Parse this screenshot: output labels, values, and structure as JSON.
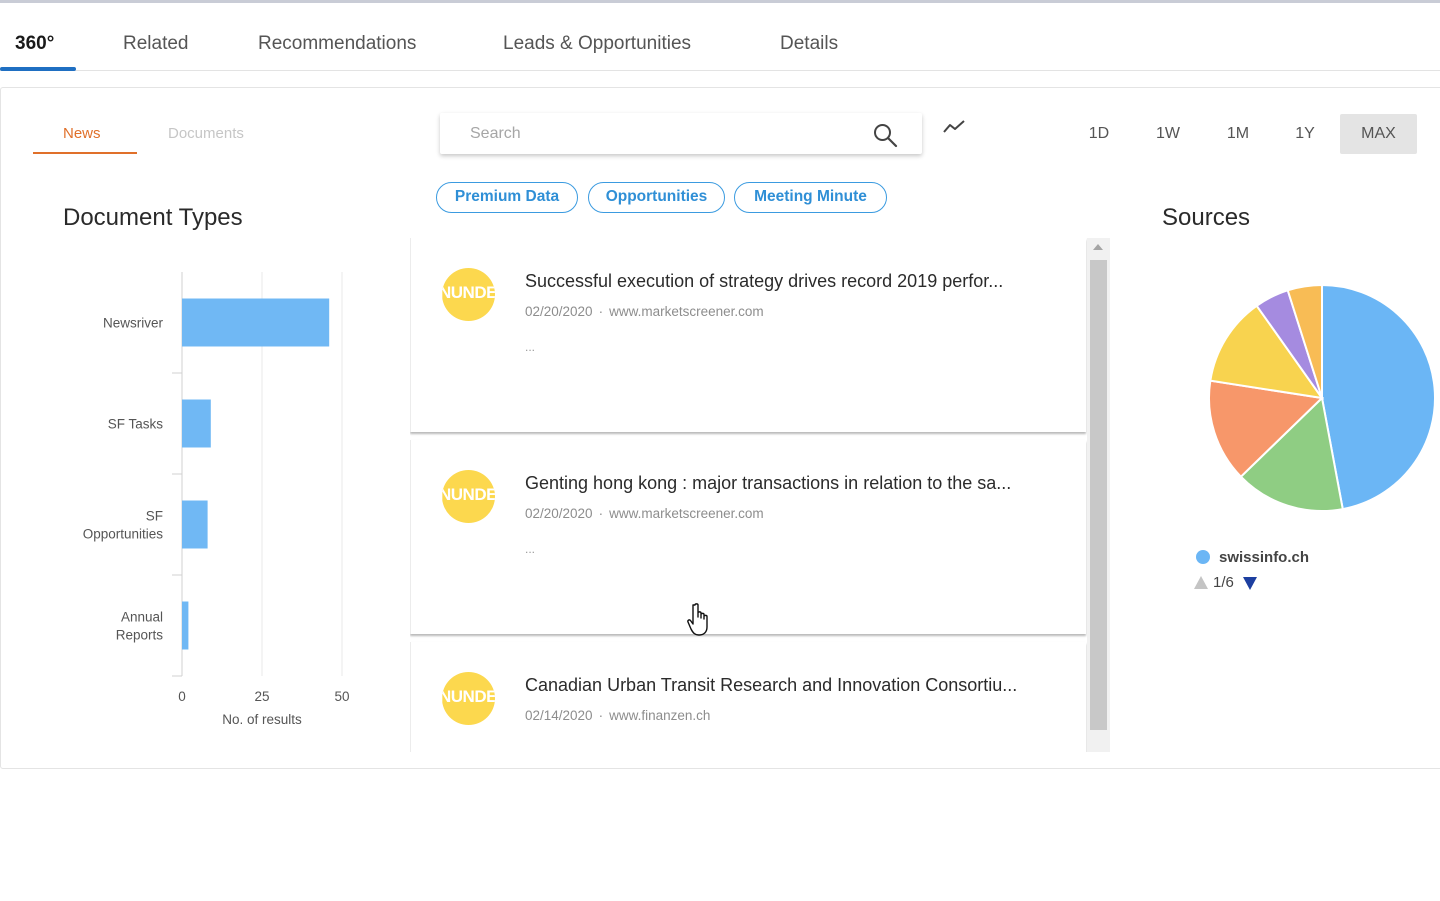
{
  "main_tabs": [
    {
      "label": "360°",
      "active": true
    },
    {
      "label": "Related"
    },
    {
      "label": "Recommendations"
    },
    {
      "label": "Leads & Opportunities"
    },
    {
      "label": "Details"
    }
  ],
  "sub_tabs": [
    {
      "label": "News",
      "active": true
    },
    {
      "label": "Documents"
    }
  ],
  "search": {
    "placeholder": "Search",
    "value": ""
  },
  "time_ranges": [
    "1D",
    "1W",
    "1M",
    "1Y",
    "MAX"
  ],
  "time_range_selected": "MAX",
  "filters": [
    "Premium Data",
    "Opportunities",
    "Meeting Minute"
  ],
  "document_types": {
    "title": "Document Types",
    "chart_data": {
      "type": "bar",
      "orientation": "horizontal",
      "categories": [
        [
          "Newsriver"
        ],
        [
          "SF Tasks"
        ],
        [
          "SF",
          "Opportunities"
        ],
        [
          "Annual",
          "Reports"
        ]
      ],
      "values": [
        46,
        9,
        8,
        2
      ],
      "xticks": [
        "0",
        "25",
        "50"
      ],
      "xlim": [
        0,
        50
      ],
      "xlabel": "No. of results",
      "bar_color": "#70b8f4",
      "grid": true
    }
  },
  "news": [
    {
      "avatar": "NUNDE",
      "title": "Successful execution of strategy drives record 2019 perfor...",
      "date": "02/20/2020",
      "source": "www.marketscreener.com",
      "snippet": "..."
    },
    {
      "avatar": "NUNDE",
      "title": "Genting hong kong : major transactions in relation to the sa...",
      "date": "02/20/2020",
      "source": "www.marketscreener.com",
      "snippet": "..."
    },
    {
      "avatar": "NUNDE",
      "title": "Canadian Urban Transit Research and Innovation Consortiu...",
      "date": "02/14/2020",
      "source": "www.finanzen.ch",
      "snippet": ""
    }
  ],
  "meta_separator": "·",
  "sources": {
    "title": "Sources",
    "chart_data": {
      "type": "pie",
      "slices": [
        {
          "value": 48,
          "color": "#6bb6f5"
        },
        {
          "value": 16,
          "color": "#8fcd83"
        },
        {
          "value": 15,
          "color": "#f7976a"
        },
        {
          "value": 13,
          "color": "#f8d34f"
        },
        {
          "value": 5,
          "color": "#a58be0"
        },
        {
          "value": 5,
          "color": "#f8bc55"
        }
      ]
    },
    "legend_label": "swissinfo.ch",
    "legend_color": "#6bb6f5",
    "pager": "1/6"
  },
  "colors": {
    "accent_blue": "#1f6fc2",
    "news_accent": "#e0702a",
    "chip_blue": "#2f8fd6",
    "avatar_yellow": "#fcd84e"
  }
}
